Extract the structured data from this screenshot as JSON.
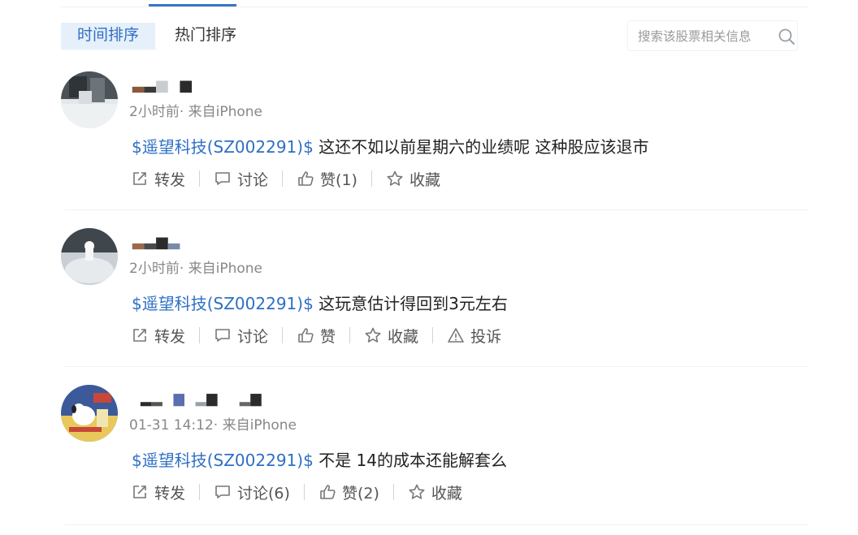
{
  "tabs": {
    "time_sort": "时间排序",
    "hot_sort": "热门排序"
  },
  "search": {
    "placeholder": "搜索该股票相关信息"
  },
  "posts": [
    {
      "meta": "2小时前· 来自iPhone",
      "stock": "$遥望科技(SZ002291)$",
      "text": " 这还不如以前星期六的业绩呢 这种股应该退市",
      "actions": {
        "share": "转发",
        "comment": "讨论",
        "like": "赞(1)",
        "fav": "收藏"
      }
    },
    {
      "meta": "2小时前· 来自iPhone",
      "stock": "$遥望科技(SZ002291)$",
      "text": " 这玩意估计得回到3元左右",
      "actions": {
        "share": "转发",
        "comment": "讨论",
        "like": "赞",
        "fav": "收藏",
        "report": "投诉"
      }
    },
    {
      "meta": "01-31 14:12· 来自iPhone",
      "stock": "$遥望科技(SZ002291)$",
      "text": " 不是 14的成本还能解套么",
      "actions": {
        "share": "转发",
        "comment": "讨论(6)",
        "like": "赞(2)",
        "fav": "收藏"
      }
    }
  ],
  "colors": {
    "accent": "#2f6fc4",
    "tab_active_bg": "#e6f0fa"
  }
}
